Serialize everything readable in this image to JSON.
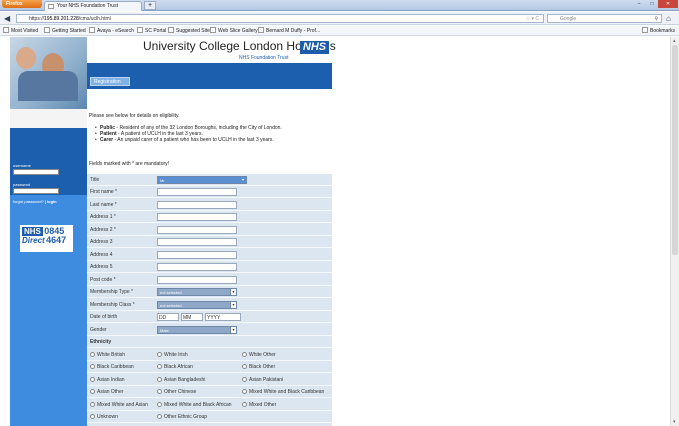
{
  "browser": {
    "app_button": "Firefox",
    "tab_title": "Your NHS Foundation Trust",
    "new_tab": "+",
    "url_host": "195.89.201.228",
    "url_prefix": "https://",
    "url_path": "/cms/uclh.html",
    "search_placeholder": "Google",
    "bookmarks": [
      "Most Visited",
      "Getting Started",
      "Avaya - eSearch",
      "SC Portal",
      "Suggested Sites",
      "Web Slice Gallery",
      "Bernard M Duffy - Prof..."
    ],
    "bookmarks_right": "Bookmarks"
  },
  "site": {
    "title": "University College London Hospitals",
    "logo": "NHS",
    "trust_name": "NHS Foundation Trust",
    "nav_tab": "Registration",
    "login": {
      "username_label": "username",
      "password_label": "password",
      "forgot_label": "forgot password?",
      "login_link": "login"
    },
    "direct": {
      "nhs": "NHS",
      "direct": "Direct",
      "num1": "0845",
      "num2": "4647"
    }
  },
  "content": {
    "intro": "Please see below for details on eligibility.",
    "eligibility": [
      {
        "term": "Public",
        "text": " - Resident of any of the 32 London Boroughs, including the City of London."
      },
      {
        "term": "Patient",
        "text": " - A patient of UCLH in the last 3 years."
      },
      {
        "term": "Carer",
        "text": " - An unpaid carer of a patient who has been to UCLH in the last 3 years."
      }
    ],
    "mandatory_note": "Fields marked with * are mandatory!"
  },
  "form": {
    "title_label": "Title",
    "title_value": "Mr",
    "fields": [
      "First name *",
      "Last name *",
      "Address 1 *",
      "Address 2 *",
      "Address 3",
      "Address 4",
      "Address 5",
      "Post code *"
    ],
    "membership_type_label": "Membership Type *",
    "membership_type_value": "not selected",
    "membership_class_label": "Membership Class *",
    "membership_class_value": "not selected",
    "dob_label": "Date of birth",
    "dob_dd": "DD",
    "dob_mm": "MM",
    "dob_yyyy": "YYYY",
    "gender_label": "Gender",
    "gender_value": "Male",
    "ethnicity_label": "Ethnicity",
    "ethnicity_rows": [
      [
        "White British",
        "White Irish",
        "White Other"
      ],
      [
        "Black Caribbean",
        "Black African",
        "Black Other"
      ],
      [
        "Asian Indian",
        "Asian Bangladeshi",
        "Asian Pakistani"
      ],
      [
        "Asian Other",
        "Other Chinese",
        "Mixed White and Black Caribbean"
      ],
      [
        "Mixed White and Asian",
        "Mixed White and Black African",
        "Mixed Other"
      ],
      [
        "Unknown",
        "Other Ethnic Group",
        ""
      ]
    ]
  },
  "colors": {
    "nhs_blue": "#1d5caa",
    "sidebar_blue": "#3d8ce0",
    "form_bg": "#dbe6f1"
  }
}
